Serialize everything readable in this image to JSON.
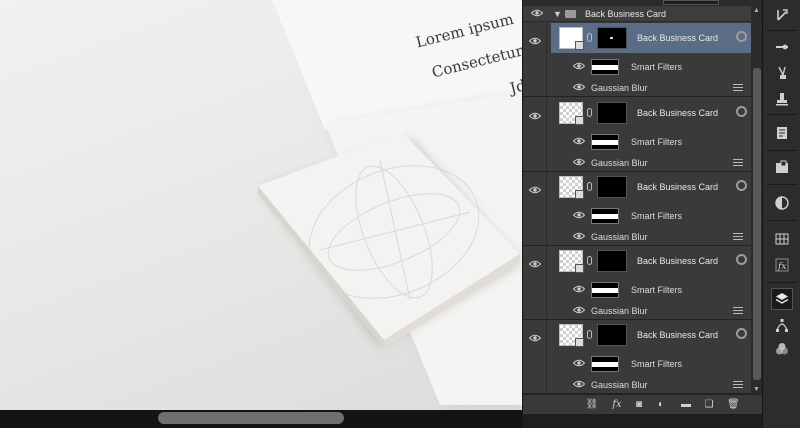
{
  "canvas": {
    "text_lines": [
      "Lorem ipsum",
      "Consectetur",
      "Jd"
    ]
  },
  "layers_panel": {
    "group": {
      "name": "Back Business Card",
      "expanded": true
    },
    "layers": [
      {
        "name": "Back Business Card",
        "selected": true,
        "filter_label": "Smart Filters",
        "effect": "Gaussian Blur"
      },
      {
        "name": "Back Business Card",
        "selected": false,
        "filter_label": "Smart Filters",
        "effect": "Gaussian Blur"
      },
      {
        "name": "Back Business Card",
        "selected": false,
        "filter_label": "Smart Filters",
        "effect": "Gaussian Blur"
      },
      {
        "name": "Back Business Card",
        "selected": false,
        "filter_label": "Smart Filters",
        "effect": "Gaussian Blur"
      },
      {
        "name": "Back Business Card",
        "selected": false,
        "filter_label": "Smart Filters",
        "effect": "Gaussian Blur"
      }
    ],
    "footer_icons": [
      "link-icon",
      "fx-icon",
      "mask-icon",
      "adjustment-icon",
      "folder-icon",
      "new-layer-icon",
      "trash-icon"
    ]
  },
  "toolstrip": {
    "icons": [
      "history-icon",
      "brush-presets-icon",
      "tool-presets-icon",
      "clone-source-icon",
      "notes-icon",
      "3d-icon",
      "adjustments-icon",
      "swatches-icon",
      "styles-icon",
      "layers-icon",
      "paths-icon",
      "channels-icon"
    ],
    "active": "layers-icon"
  },
  "colors": {
    "selection": "#5a6c86",
    "panel": "#393939",
    "toolstrip": "#2c2c2c"
  }
}
